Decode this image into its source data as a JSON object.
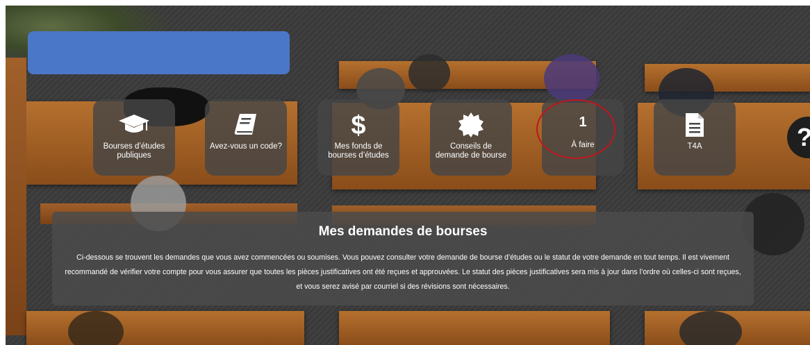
{
  "tiles": [
    {
      "label": "Bourses d’études publiques",
      "icon": "graduation-cap-icon"
    },
    {
      "label": "Avez-vous un code?",
      "icon": "book-icon"
    },
    {
      "label": "Mes fonds de bourses d’études",
      "icon": "dollar-icon"
    },
    {
      "label": "Conseils de demande de bourse",
      "icon": "badge-icon"
    },
    {
      "label": "À faire",
      "count": "1"
    },
    {
      "label": "T4A",
      "icon": "document-icon"
    }
  ],
  "help": {
    "glyph": "?"
  },
  "panel": {
    "title": "Mes demandes de bourses",
    "text": "Ci-dessous se trouvent les demandes que vous avez commencées ou soumises. Vous pouvez consulter votre demande de bourse d’études ou le statut de votre demande en tout temps. Il est vivement recommandé de vérifier votre compte pour vous assurer que toutes les pièces justificatives ont été reçues et approuvées. Le statut des pièces justificatives sera mis à jour dans l’ordre où celles-ci sont reçues, et vous serez avisé par courriel si des révisions sont nécessaires."
  },
  "colors": {
    "banner": "#4a77c8",
    "tile_bg": "#464646",
    "highlight_ring": "#c0151c"
  }
}
